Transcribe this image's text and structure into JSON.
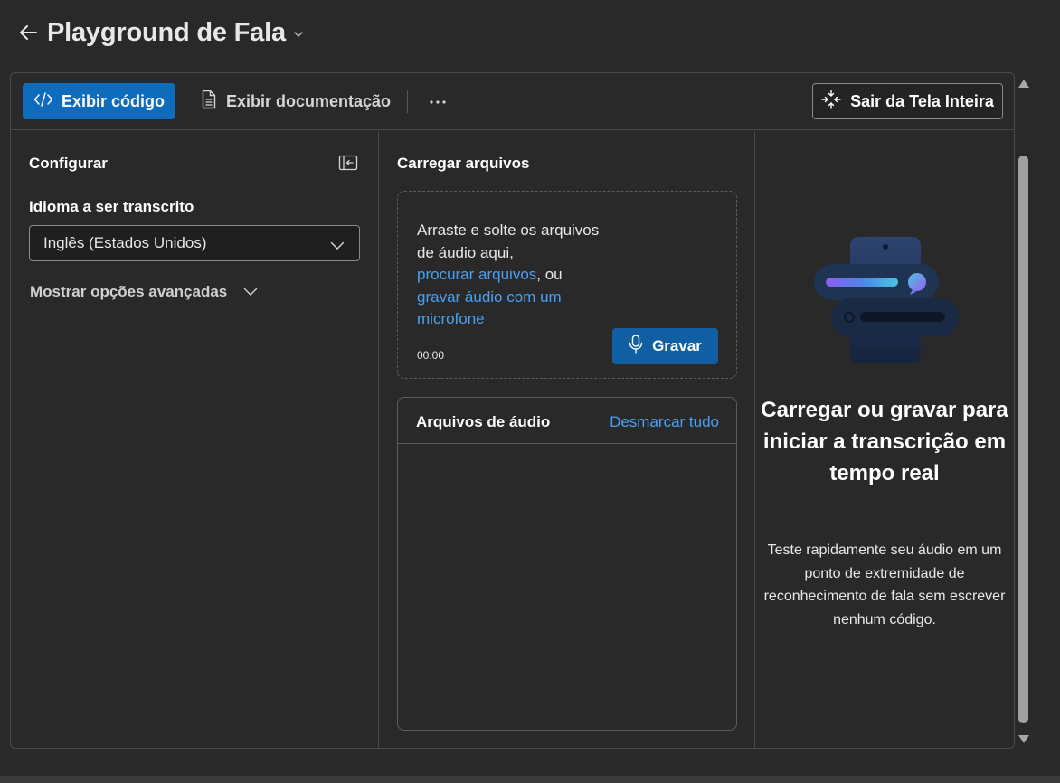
{
  "header": {
    "title": "Playground de Fala"
  },
  "toolbar": {
    "view_code_label": "Exibir código",
    "view_docs_label": "Exibir documentação",
    "more_label": "···",
    "exit_fullscreen_label": "Sair da Tela Inteira"
  },
  "configure": {
    "title": "Configurar",
    "language_label": "Idioma a ser transcrito",
    "language_selected": "Inglês (Estados Unidos)",
    "advanced_options_label": "Mostrar opções avançadas"
  },
  "upload": {
    "title": "Carregar arquivos",
    "drop_text_line1": "Arraste e solte os arquivos de áudio aqui,",
    "browse_link": "procurar arquivos",
    "drop_or": ", ou",
    "record_link": "gravar áudio com um microfone",
    "timer": "00:00",
    "record_button": "Gravar"
  },
  "audio_files": {
    "title": "Arquivos de áudio",
    "deselect_all": "Desmarcar tudo"
  },
  "empty_state": {
    "title": "Carregar ou gravar para iniciar a transcrição em tempo real",
    "description": "Teste rapidamente seu áudio em um ponto de extremidade de reconhecimento de fala sem escrever nenhum código."
  },
  "colors": {
    "background": "#292929",
    "primary_button": "#0f6cbd",
    "record_button": "#115ea3",
    "link": "#4aa0f0",
    "border": "#4a4a4a"
  },
  "icons": {
    "back": "arrow-left-icon",
    "title_menu": "chevron-down-icon",
    "view_code": "code-icon",
    "view_docs": "document-icon",
    "more": "more-horizontal-icon",
    "exit_fullscreen": "collapse-arrows-icon",
    "collapse_panel": "panel-collapse-icon",
    "language_dropdown": "chevron-down-icon",
    "advanced_toggle": "chevron-down-icon",
    "record": "microphone-icon",
    "illustration": "speech-phone-illustration"
  }
}
